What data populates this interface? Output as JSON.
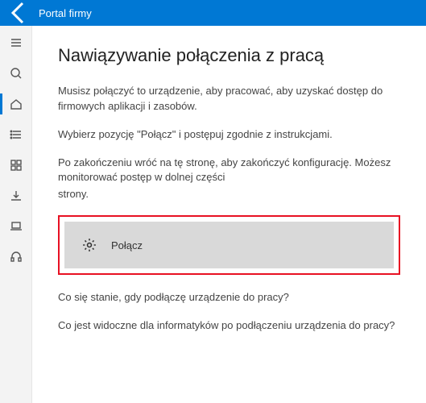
{
  "titlebar": {
    "title": "Portal firmy"
  },
  "sidebar": {
    "items": [
      {
        "name": "hamburger"
      },
      {
        "name": "search"
      },
      {
        "name": "home"
      },
      {
        "name": "list"
      },
      {
        "name": "apps"
      },
      {
        "name": "downloads"
      },
      {
        "name": "devices"
      },
      {
        "name": "support"
      }
    ]
  },
  "page": {
    "title": "Nawiązywanie połączenia z pracą",
    "para1": "Musisz połączyć to urządzenie, aby pracować, aby uzyskać dostęp do firmowych aplikacji i zasobów.",
    "para2": "Wybierz pozycję \"Połącz\" i postępuj zgodnie z instrukcjami.",
    "para3": "Po zakończeniu wróć na tę stronę, aby zakończyć konfigurację. Możesz monitorować postęp w dolnej części",
    "para3b": "strony.",
    "connect_label": "Połącz",
    "faq1": "Co się stanie, gdy podłączę urządzenie do pracy?",
    "faq2": "Co jest widoczne dla informatyków po podłączeniu urządzenia do pracy?"
  }
}
